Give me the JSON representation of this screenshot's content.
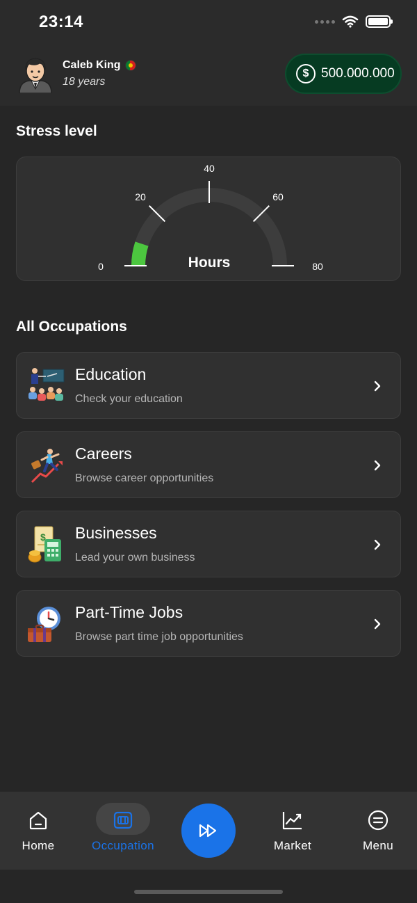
{
  "status_bar": {
    "time": "23:14"
  },
  "profile": {
    "name": "Caleb King",
    "age": "18 years",
    "balance_icon": "$",
    "balance": "500.000.000",
    "balance_color": "#063b22"
  },
  "stress": {
    "title": "Stress level",
    "unit_label": "Hours",
    "gauge_min": 0,
    "gauge_max": 80,
    "gauge_value": 8,
    "ticks": [
      "0",
      "20",
      "40",
      "60",
      "80"
    ],
    "fill_color": "#4cc63f"
  },
  "occupations": {
    "title": "All Occupations",
    "items": [
      {
        "title": "Education",
        "subtitle": "Check your education",
        "icon": "classroom-icon"
      },
      {
        "title": "Careers",
        "subtitle": "Browse career opportunities",
        "icon": "career-growth-icon"
      },
      {
        "title": "Businesses",
        "subtitle": "Lead your own business",
        "icon": "business-finance-icon"
      },
      {
        "title": "Part-Time Jobs",
        "subtitle": "Browse part time job opportunities",
        "icon": "briefcase-clock-icon"
      }
    ]
  },
  "nav": {
    "home": "Home",
    "occupation": "Occupation",
    "market": "Market",
    "menu": "Menu",
    "active": "Occupation",
    "active_color": "#1a73e8"
  }
}
